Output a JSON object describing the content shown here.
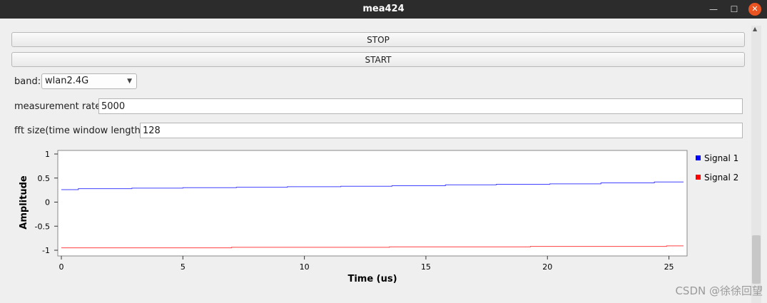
{
  "window": {
    "title": "mea424",
    "minimize_glyph": "—",
    "maximize_glyph": "☐",
    "close_glyph": "✕"
  },
  "buttons": {
    "stop_label": "STOP",
    "start_label": "START"
  },
  "form": {
    "band_label": "band:",
    "band_value": "wlan2.4G",
    "rate_label": "measurement rate:",
    "rate_value": "5000",
    "fft_label": "fft size(time window length):",
    "fft_value": "128"
  },
  "scrollbar": {
    "up_glyph": "▲"
  },
  "watermark": "CSDN @徐徐回望",
  "chart_data": {
    "type": "line",
    "xlabel": "Time (us)",
    "ylabel": "Amplitude",
    "xlim": [
      0,
      25.6
    ],
    "ylim": [
      -1,
      1
    ],
    "x_ticks": [
      0,
      5,
      10,
      15,
      20,
      25
    ],
    "y_ticks": [
      1,
      0.5,
      0,
      -0.5,
      -1
    ],
    "legend_position": "right",
    "series": [
      {
        "name": "Signal 1",
        "color": "#0000ff",
        "x": [
          0,
          0.7,
          0.7,
          2.9,
          2.9,
          5.0,
          5.0,
          7.2,
          7.2,
          9.3,
          9.3,
          11.5,
          11.5,
          13.6,
          13.6,
          15.8,
          15.8,
          17.9,
          17.9,
          20.1,
          20.1,
          22.2,
          22.2,
          24.4,
          24.4,
          25.6
        ],
        "y": [
          0.26,
          0.26,
          0.28,
          0.28,
          0.29,
          0.29,
          0.3,
          0.3,
          0.31,
          0.31,
          0.32,
          0.32,
          0.33,
          0.33,
          0.34,
          0.34,
          0.36,
          0.36,
          0.37,
          0.37,
          0.38,
          0.38,
          0.4,
          0.4,
          0.42,
          0.42
        ]
      },
      {
        "name": "Signal 2",
        "color": "#ff0000",
        "x": [
          0,
          7.0,
          7.0,
          13.5,
          13.5,
          19.3,
          19.3,
          24.9,
          24.9,
          25.6
        ],
        "y": [
          -0.95,
          -0.95,
          -0.94,
          -0.94,
          -0.93,
          -0.93,
          -0.92,
          -0.92,
          -0.91,
          -0.91
        ]
      }
    ]
  }
}
